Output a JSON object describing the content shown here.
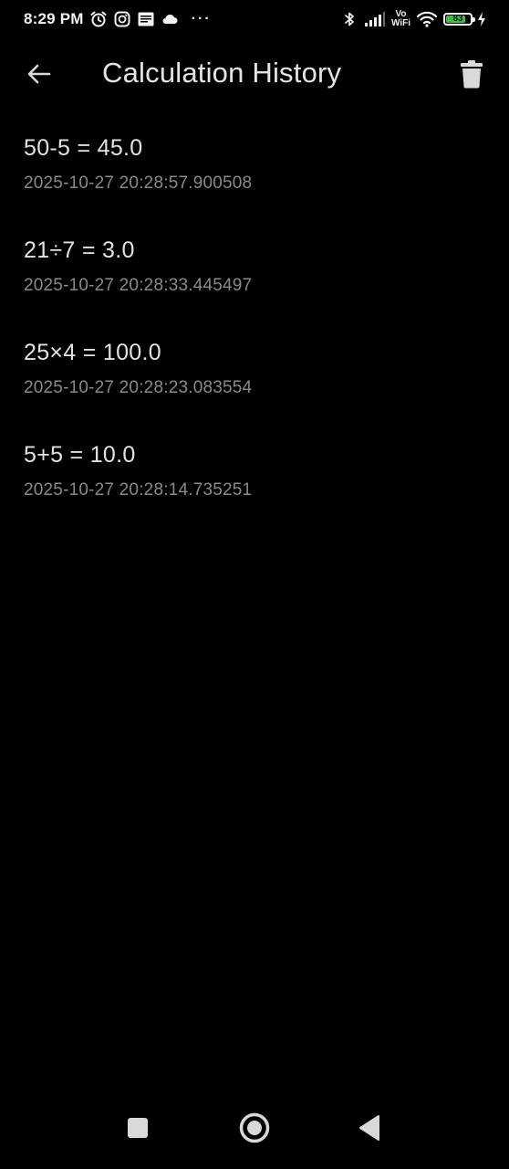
{
  "status_bar": {
    "time": "8:29 PM",
    "more_indicator": "···",
    "wifi_label_top": "Vo",
    "wifi_label_bottom": "WiFi",
    "battery_level": "83",
    "battery_fraction": 0.83,
    "left_icons": [
      "alarm-icon",
      "instagram-icon",
      "news-icon",
      "cloud-icon"
    ],
    "right_icons": [
      "bluetooth-icon",
      "signal-icon",
      "wifi-icon",
      "battery-icon",
      "charging-icon"
    ]
  },
  "app_bar": {
    "title": "Calculation History",
    "back_icon": "arrow-left-icon",
    "delete_icon": "trash-icon"
  },
  "history": [
    {
      "expression": "50-5 = 45.0",
      "timestamp": "2025-10-27 20:28:57.900508"
    },
    {
      "expression": "21÷7 = 3.0",
      "timestamp": "2025-10-27 20:28:33.445497"
    },
    {
      "expression": "25×4 = 100.0",
      "timestamp": "2025-10-27 20:28:23.083554"
    },
    {
      "expression": "5+5 = 10.0",
      "timestamp": "2025-10-27 20:28:14.735251"
    }
  ],
  "nav_bar": {
    "icons": [
      "recents-square-icon",
      "home-circle-icon",
      "back-triangle-icon"
    ]
  },
  "colors": {
    "background": "#000000",
    "primary_text": "#e2e2e2",
    "secondary_text": "#8a8a8a",
    "battery_fill": "#3fbf4a",
    "icon": "#d9d9d9"
  }
}
